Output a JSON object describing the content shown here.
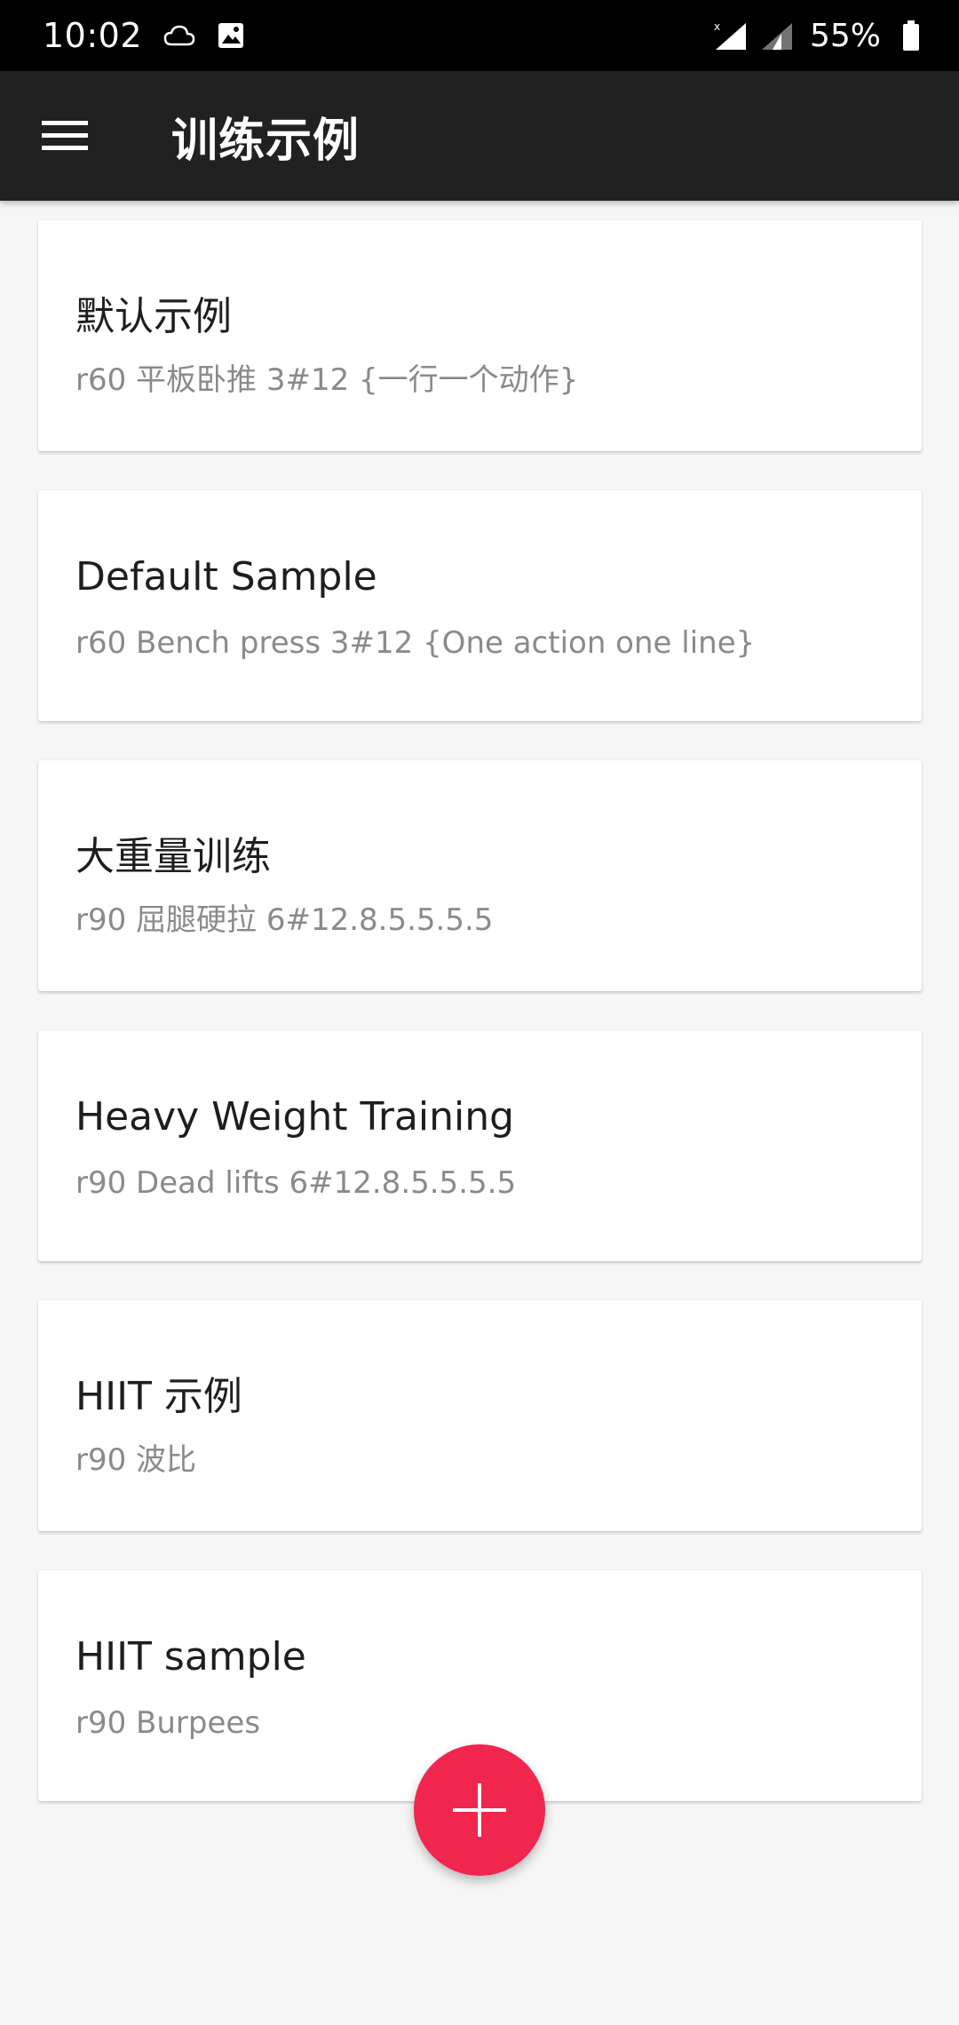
{
  "status_bar": {
    "time": "10:02",
    "battery": "55%",
    "icons": [
      "cloud-icon",
      "image-icon",
      "wifi-icon",
      "signal-icon",
      "battery-icon"
    ]
  },
  "app_bar": {
    "title": "训练示例",
    "menu_icon": "hamburger-menu-icon",
    "background": "#212121"
  },
  "cards": [
    {
      "title": "默认示例",
      "subtitle": "r60 平板卧推 3#12 {一行一个动作}"
    },
    {
      "title": "Default Sample",
      "subtitle": "r60 Bench press 3#12 {One action one line}"
    },
    {
      "title": "大重量训练",
      "subtitle": "r90 屈腿硬拉 6#12.8.5.5.5.5"
    },
    {
      "title": "Heavy Weight Training",
      "subtitle": "r90 Dead lifts 6#12.8.5.5.5.5"
    },
    {
      "title": "HIIT 示例",
      "subtitle": "r90 波比"
    },
    {
      "title": "HIIT sample",
      "subtitle": "r90 Burpees"
    }
  ],
  "fab": {
    "icon": "plus-icon",
    "color": "#f0264e"
  }
}
